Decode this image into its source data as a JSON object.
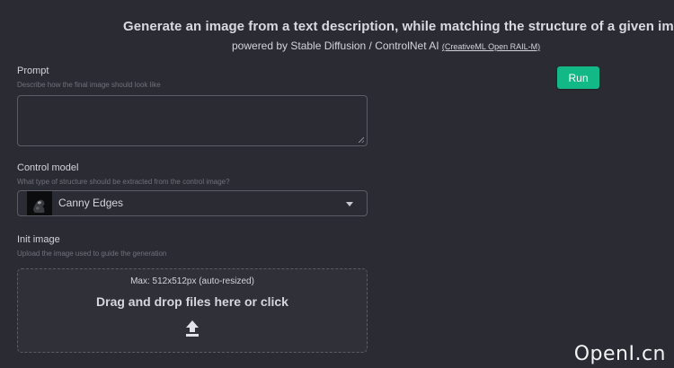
{
  "header": {
    "title": "Generate an image from a text description, while matching the structure of a given image",
    "subtitle": "powered by Stable Diffusion / ControlNet AI",
    "license_link": "(CreativeML Open RAIL-M)"
  },
  "run_button": {
    "label": "Run"
  },
  "prompt": {
    "label": "Prompt",
    "description": "Describe how the final image should look like",
    "value": "",
    "placeholder": ""
  },
  "control_model": {
    "label": "Control model",
    "description": "What type of structure should be extracted from the control image?",
    "selected": "Canny Edges",
    "thumbnail_icon": "dark-silhouette-thumbnail",
    "chevron_icon": "chevron-down-icon"
  },
  "init_image": {
    "label": "Init image",
    "description": "Upload the image used to guide the generation",
    "max_note": "Max: 512x512px (auto-resized)",
    "drop_text": "Drag and drop files here or click",
    "upload_icon": "upload-icon"
  },
  "watermark": "OpenI.cn",
  "colors": {
    "background": "#2b2c33",
    "accent": "#12b886",
    "border": "#5a5c66",
    "muted_text": "#6f717b"
  }
}
